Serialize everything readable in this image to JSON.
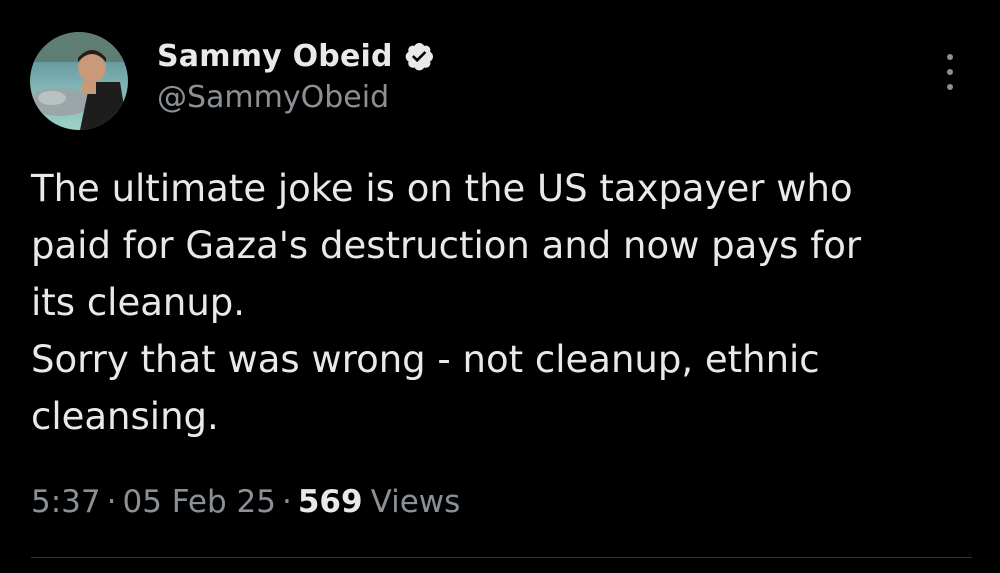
{
  "author": {
    "display_name": "Sammy Obeid",
    "handle": "@SammyObeid",
    "verified": true,
    "avatar_icon": "avatar-photo-with-dolphin",
    "verified_icon": "verified-badge-icon"
  },
  "menu": {
    "icon": "more-vertical-icon"
  },
  "tweet": {
    "text": "The ultimate joke is on the US taxpayer who\npaid for Gaza's destruction and now pays for\nits cleanup.\nSorry that was wrong - not cleanup, ethnic\ncleansing."
  },
  "meta": {
    "time": "5:37",
    "separator": "·",
    "date": "05 Feb 25",
    "views_count": "569",
    "views_label": "Views"
  },
  "colors": {
    "background": "#000000",
    "primary_text": "#e7e9ea",
    "secondary_text": "#8b9095",
    "divider": "#2f3336"
  }
}
